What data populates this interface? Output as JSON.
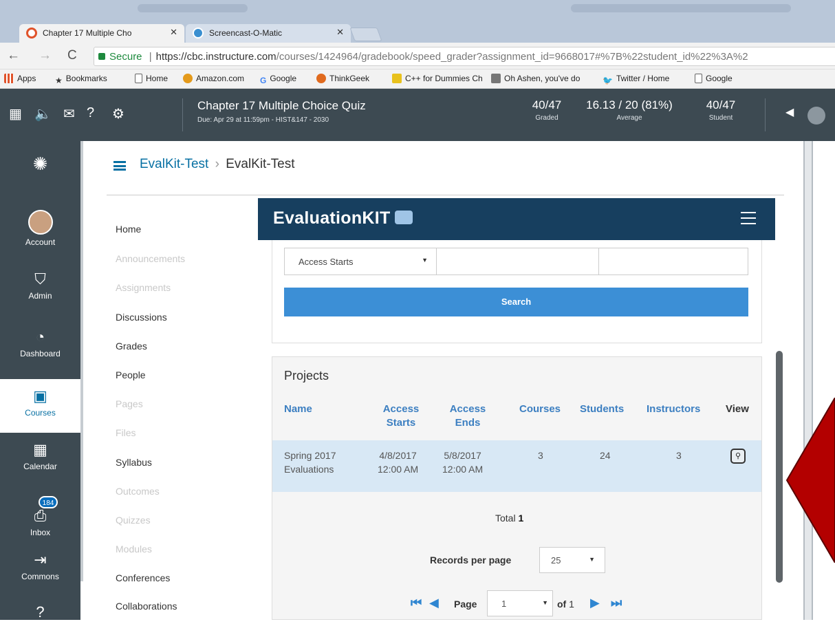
{
  "browser": {
    "tabs": [
      {
        "label": "Chapter 17 Multiple Cho",
        "active": true
      },
      {
        "label": "Screencast-O-Matic",
        "active": false
      }
    ],
    "secure_label": "Secure",
    "url_host": "https://cbc.instructure.com",
    "url_path": "/courses/1424964/gradebook/speed_grader?assignment_id=9668017#%7B%22student_id%22%3A%2",
    "bookmarks": [
      {
        "label": "Apps"
      },
      {
        "label": "Bookmarks"
      },
      {
        "label": "Home"
      },
      {
        "label": "Amazon.com"
      },
      {
        "label": "Google"
      },
      {
        "label": "ThinkGeek"
      },
      {
        "label": "C++ for Dummies Ch"
      },
      {
        "label": "Oh Ashen, you've do"
      },
      {
        "label": "Twitter / Home"
      },
      {
        "label": "Google"
      }
    ]
  },
  "speedgrader": {
    "title": "Chapter 17 Multiple Choice Quiz",
    "due": "Due: Apr 29 at 11:59pm - HIST&147 - 2030",
    "graded_value": "40/47",
    "graded_label": "Graded",
    "average_value": "16.13 / 20 (81%)",
    "average_label": "Average",
    "student_value": "40/47",
    "student_label": "Student"
  },
  "global_nav": {
    "account": "Account",
    "admin": "Admin",
    "dashboard": "Dashboard",
    "courses": "Courses",
    "calendar": "Calendar",
    "inbox": "Inbox",
    "inbox_count": "184",
    "commons": "Commons"
  },
  "breadcrumb": {
    "course": "EvalKit-Test",
    "separator": "›",
    "current": "EvalKit-Test"
  },
  "course_nav": [
    {
      "label": "Home",
      "enabled": true
    },
    {
      "label": "Announcements",
      "enabled": false
    },
    {
      "label": "Assignments",
      "enabled": false
    },
    {
      "label": "Discussions",
      "enabled": true
    },
    {
      "label": "Grades",
      "enabled": true
    },
    {
      "label": "People",
      "enabled": true
    },
    {
      "label": "Pages",
      "enabled": false
    },
    {
      "label": "Files",
      "enabled": false
    },
    {
      "label": "Syllabus",
      "enabled": true
    },
    {
      "label": "Outcomes",
      "enabled": false
    },
    {
      "label": "Quizzes",
      "enabled": false
    },
    {
      "label": "Modules",
      "enabled": false
    },
    {
      "label": "Conferences",
      "enabled": true
    },
    {
      "label": "Collaborations",
      "enabled": true
    }
  ],
  "evalkit": {
    "logo": "EvaluationKIT",
    "filter_select": "Access Starts",
    "search_button": "Search",
    "projects_title": "Projects",
    "columns": {
      "name": "Name",
      "access_starts": "Access Starts",
      "access_ends": "Access Ends",
      "courses": "Courses",
      "students": "Students",
      "instructors": "Instructors",
      "view": "View"
    },
    "row": {
      "name_line1": "Spring 2017",
      "name_line2": "Evaluations",
      "starts_date": "4/8/2017",
      "starts_time": "12:00 AM",
      "ends_date": "5/8/2017",
      "ends_time": "12:00 AM",
      "courses": "3",
      "students": "24",
      "instructors": "3"
    },
    "total_label": "Total",
    "total_value": "1",
    "records_per_page_label": "Records per page",
    "records_per_page_value": "25",
    "page_label": "Page",
    "page_value": "1",
    "of_label": "of",
    "page_total": "1"
  },
  "colors": {
    "canvas_nav": "#3d4a52",
    "canvas_blue": "#0770a3",
    "evalkit_bar": "#173f5f",
    "search_button": "#3c8fd6",
    "highlight_row": "#d8e8f5",
    "annotation_arrow": "#b30000"
  }
}
